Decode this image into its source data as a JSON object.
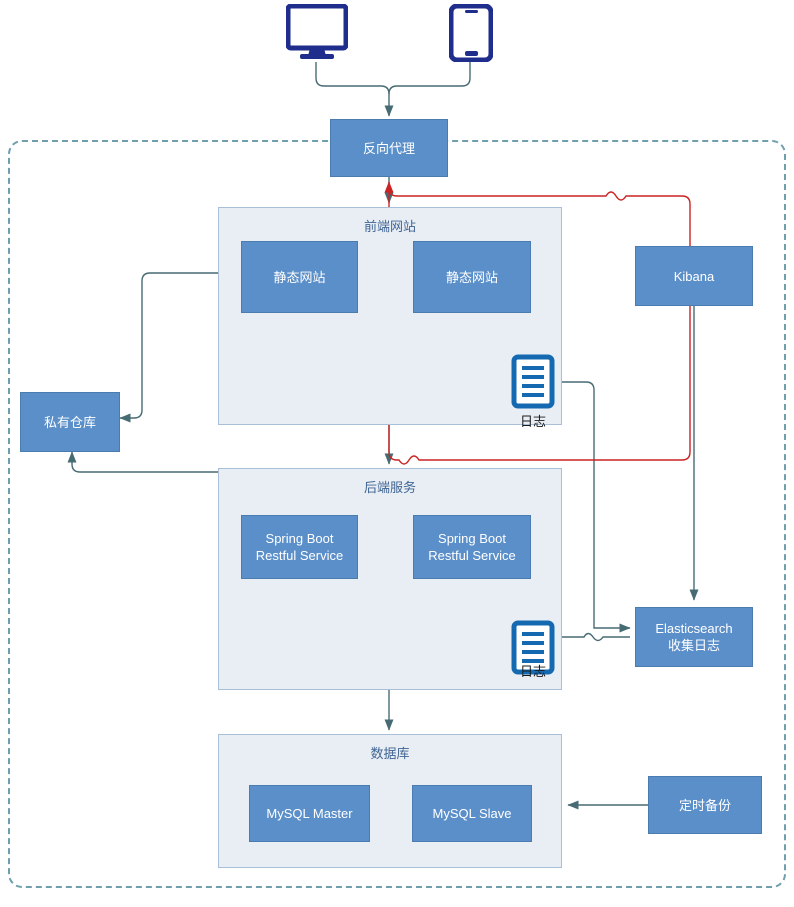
{
  "diagram": {
    "title": "Web Application Deployment Architecture",
    "colors": {
      "node_fill": "#5b8fc9",
      "node_border": "#4a7cb0",
      "group_fill": "#e9eef5",
      "group_border": "#a9bfd8",
      "zone_border": "#6f9ead",
      "wire": "#476b73",
      "wire_alert": "#cc2222",
      "device_icon": "#1f2d8c",
      "log_icon": "#1569b0",
      "node_text": "#ffffff",
      "group_title_text": "#3f6592"
    },
    "devices": [
      {
        "name": "desktop-monitor-icon",
        "icon": "monitor-icon"
      },
      {
        "name": "mobile-phone-icon",
        "icon": "smartphone-icon"
      }
    ],
    "nodes": [
      {
        "id": "reverse-proxy",
        "label": "反向代理"
      },
      {
        "id": "static-site-1",
        "label": "静态网站"
      },
      {
        "id": "static-site-2",
        "label": "静态网站"
      },
      {
        "id": "private-registry",
        "label": "私有仓库"
      },
      {
        "id": "kibana",
        "label": "Kibana"
      },
      {
        "id": "spring-boot-1",
        "label": "Spring Boot\nRestful Service",
        "line1": "Spring Boot",
        "line2": "Restful Service"
      },
      {
        "id": "spring-boot-2",
        "label": "Spring Boot\nRestful Service",
        "line1": "Spring Boot",
        "line2": "Restful Service"
      },
      {
        "id": "elasticsearch",
        "label": "Elasticsearch\n收集日志",
        "line1": "Elasticsearch",
        "line2": "收集日志"
      },
      {
        "id": "mysql-master",
        "label": "MySQL Master"
      },
      {
        "id": "mysql-slave",
        "label": "MySQL Slave"
      },
      {
        "id": "scheduled-backup",
        "label": "定时备份"
      }
    ],
    "groups": [
      {
        "id": "frontend-group",
        "title": "前端网站"
      },
      {
        "id": "backend-group",
        "title": "后端服务"
      },
      {
        "id": "database-group",
        "title": "数据库"
      }
    ],
    "log_icons": [
      {
        "id": "frontend-log",
        "label": "日志"
      },
      {
        "id": "backend-log",
        "label": "日志"
      }
    ]
  }
}
